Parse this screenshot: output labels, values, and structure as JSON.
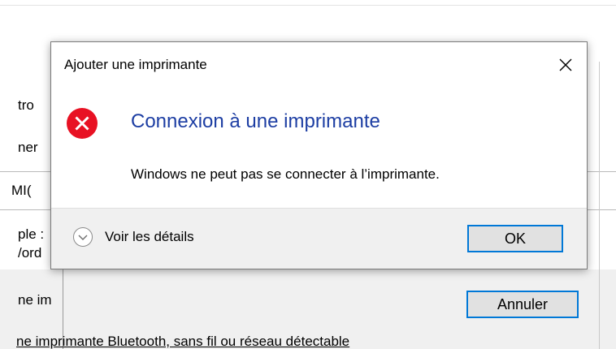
{
  "background_window": {
    "fragments": [
      "tro",
      "ner",
      "MI(",
      "ple :",
      "/ord",
      "ne im",
      "ne imprimante Bluetooth, sans fil ou réseau détectable"
    ],
    "cancel_label": "Annuler"
  },
  "dialog": {
    "title": "Ajouter une imprimante",
    "close_glyph": "✕",
    "main_instruction": "Connexion à une imprimante",
    "content": "Windows ne peut pas se connecter à l’imprimante.",
    "details_label": "Voir les détails",
    "ok_label": "OK",
    "icon": "error-icon",
    "colors": {
      "error": "#e81123",
      "instruction": "#1d3ea3",
      "button_focus": "#0078d7"
    }
  }
}
